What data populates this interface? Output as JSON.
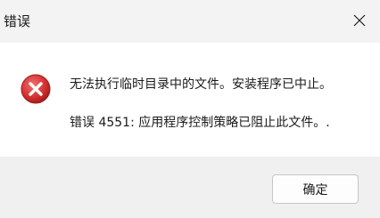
{
  "window": {
    "title": "错误",
    "close_icon": "close-icon"
  },
  "content": {
    "icon": "error-icon",
    "message": "无法执行临时目录中的文件。安装程序已中止。",
    "detail": "错误 4551: 应用程序控制策略已阻止此文件。."
  },
  "footer": {
    "ok_label": "确定"
  },
  "colors": {
    "titlebar_bg": "#f3f3f3",
    "footer_bg": "#f0f0f0",
    "error_red": "#d83a3a"
  }
}
